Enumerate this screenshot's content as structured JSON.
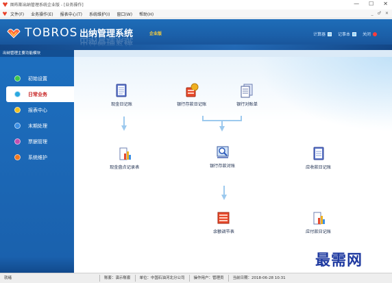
{
  "window": {
    "title": "图布斯出纳管理系统企业版 - [业务操作]",
    "min": "—",
    "max": "☐",
    "close": "✕"
  },
  "menubar": {
    "items": [
      "文件(F)",
      "业务操作(E)",
      "报表中心(T)",
      "系统维护(I)",
      "窗口(W)",
      "帮助(H)"
    ],
    "mdi": [
      "_",
      "♂",
      "✕"
    ]
  },
  "banner": {
    "brand": "TOBROS",
    "system_name": "出纳管理系统",
    "edition": "企业版",
    "tools": [
      {
        "label": "计算器",
        "icon": "calculator-icon",
        "color": "#9ad7ff"
      },
      {
        "label": "记事本",
        "icon": "notepad-icon",
        "color": "#9ad7ff"
      },
      {
        "label": "关闭",
        "icon": "close-icon",
        "color": "#ff3b3b"
      }
    ]
  },
  "sidebar": {
    "title": "出纳管理主要功能模块",
    "items": [
      {
        "label": "初始设置",
        "color": "#3ec64a"
      },
      {
        "label": "日常业务",
        "color": "#2aa8e0",
        "active": true
      },
      {
        "label": "报表中心",
        "color": "#f0c020"
      },
      {
        "label": "末期处理",
        "color": "#3b8fe6"
      },
      {
        "label": "票据管理",
        "color": "#c04fb0"
      },
      {
        "label": "系统维护",
        "color": "#f07820"
      }
    ]
  },
  "workspace": {
    "nodes": [
      {
        "label": "现金日记账",
        "icon": "cash-journal-icon"
      },
      {
        "label": "银行存款日记账",
        "icon": "bank-deposit-journal-icon"
      },
      {
        "label": "银行对账单",
        "icon": "bank-statement-icon"
      },
      {
        "label": "现金盘点记录表",
        "icon": "cash-count-icon"
      },
      {
        "label": "银行存款对账",
        "icon": "bank-reconcile-icon"
      },
      {
        "label": "应收款日记账",
        "icon": "receivable-journal-icon"
      },
      {
        "label": "余额调节表",
        "icon": "balance-adjust-icon"
      },
      {
        "label": "应付款日记账",
        "icon": "payable-journal-icon"
      }
    ]
  },
  "watermark": "最需网",
  "status": {
    "ready": "就绪",
    "ledger": "账套：演示账套",
    "unit": "单位：中国石油河北分公司",
    "user": "操作用户：管理员",
    "date": "当前日期：2018-06-28 10:31"
  },
  "colors": {
    "banner": "#1b5fa8",
    "sidebar": "#1a60ac",
    "active_label": "#c62020",
    "arrow": "#9cc9ee",
    "watermark": "#1f3aa0"
  }
}
